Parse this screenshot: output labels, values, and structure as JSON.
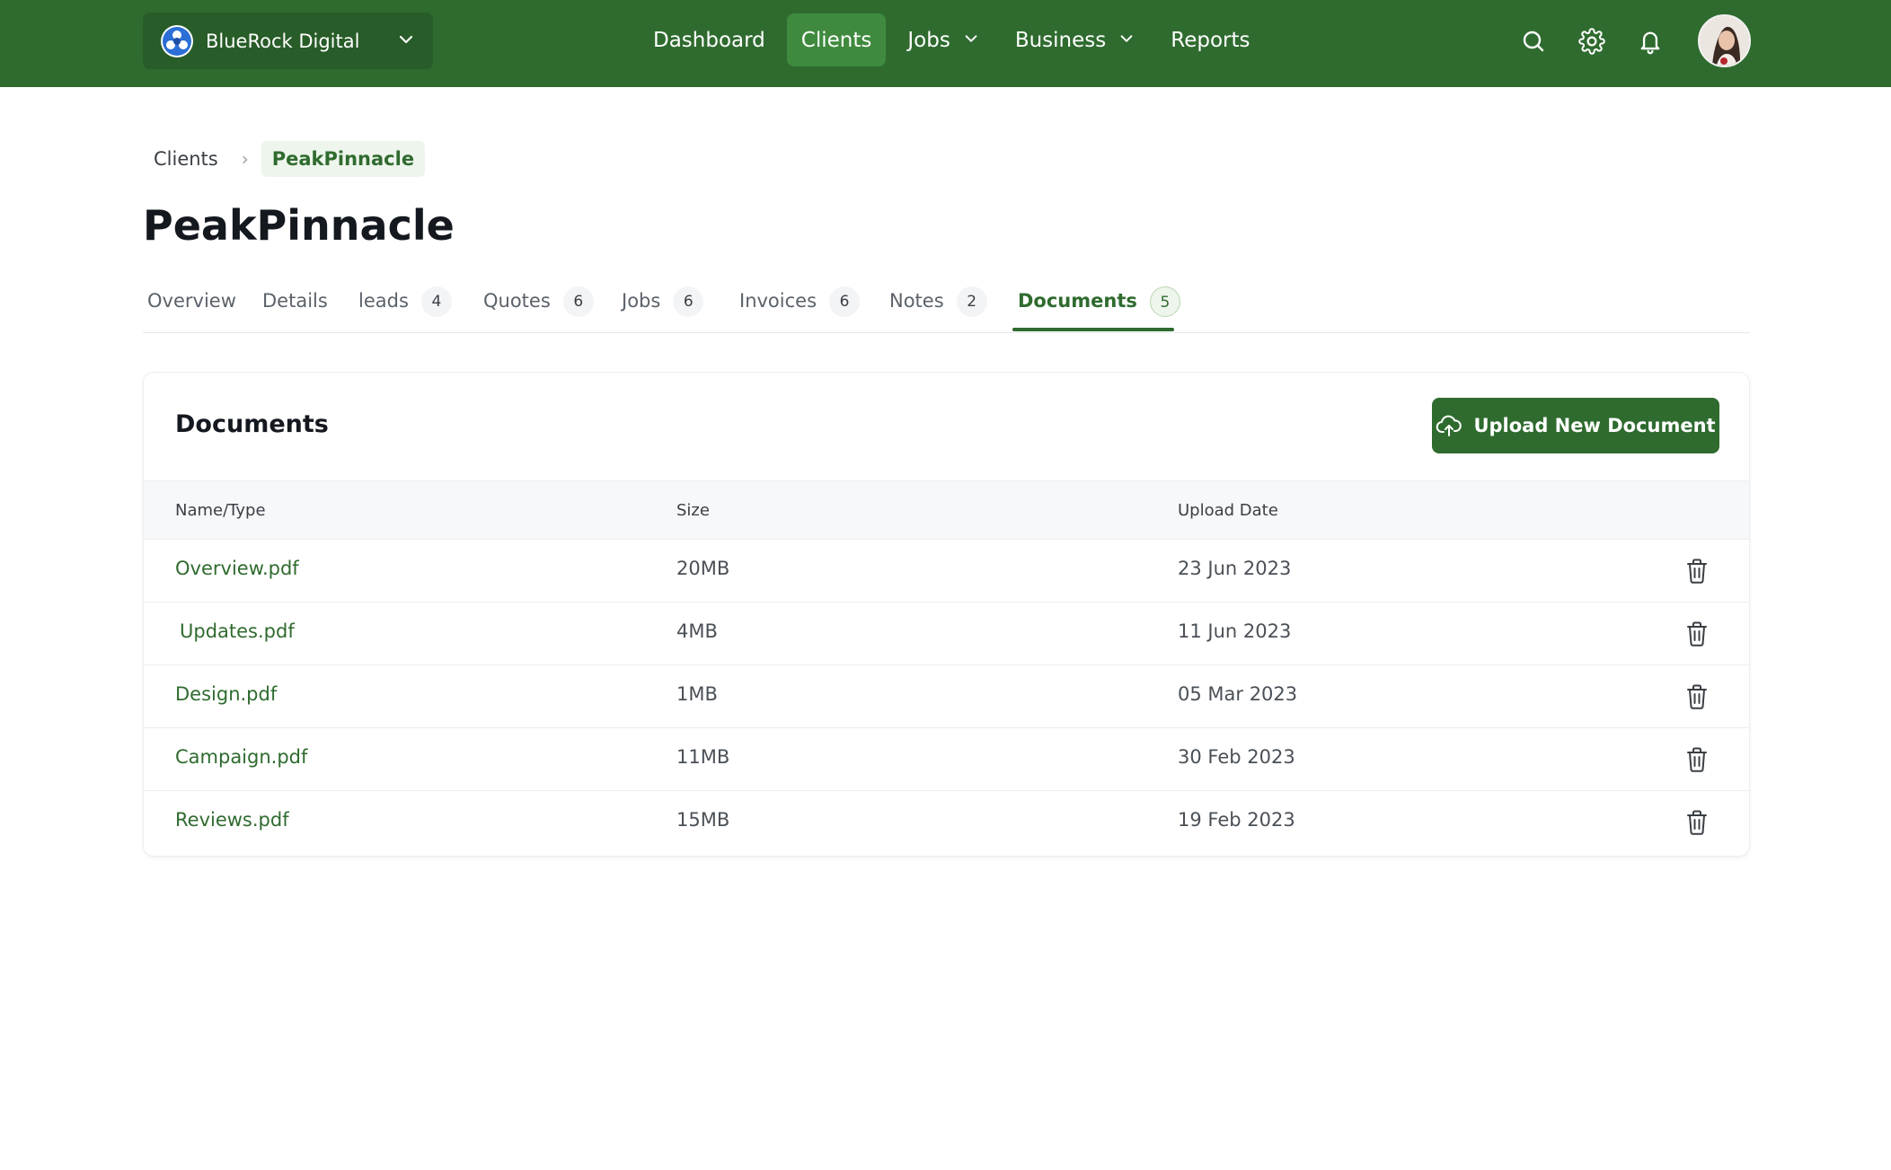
{
  "org": {
    "name": "BlueRock Digital"
  },
  "nav": {
    "items": [
      {
        "label": "Dashboard"
      },
      {
        "label": "Clients"
      },
      {
        "label": "Jobs"
      },
      {
        "label": "Business"
      },
      {
        "label": "Reports"
      }
    ],
    "active": "Clients"
  },
  "header_icons": [
    "search-icon",
    "gear-icon",
    "bell-icon"
  ],
  "breadcrumb": {
    "parent": "Clients",
    "separator": "›",
    "current": "PeakPinnacle"
  },
  "page": {
    "title": "PeakPinnacle"
  },
  "tabs": [
    {
      "label": "Overview",
      "count": ""
    },
    {
      "label": "Details",
      "count": ""
    },
    {
      "label": "leads",
      "count": "4"
    },
    {
      "label": "Quotes",
      "count": "6"
    },
    {
      "label": "Jobs",
      "count": "6"
    },
    {
      "label": "Invoices",
      "count": "6"
    },
    {
      "label": "Notes",
      "count": "2"
    },
    {
      "label": "Documents",
      "count": "5"
    }
  ],
  "active_tab": "Documents",
  "documents": {
    "title": "Documents",
    "upload_label": "Upload New Document",
    "columns": [
      "Name/Type",
      "Size",
      "Upload Date"
    ],
    "rows": [
      {
        "name": "Overview.pdf",
        "size": "20MB",
        "date": "23 Jun 2023"
      },
      {
        "name": "Updates.pdf",
        "size": "4MB",
        "date": "11 Jun 2023"
      },
      {
        "name": "Design.pdf",
        "size": "1MB",
        "date": "05 Mar 2023"
      },
      {
        "name": "Campaign.pdf",
        "size": "11MB",
        "date": "30 Feb 2023"
      },
      {
        "name": "Reviews.pdf",
        "size": "15MB",
        "date": "19 Feb 2023"
      }
    ]
  },
  "colors": {
    "brand": "#2f6b2f",
    "brand_active": "#3f8a3f",
    "link": "#2f6b2f"
  }
}
